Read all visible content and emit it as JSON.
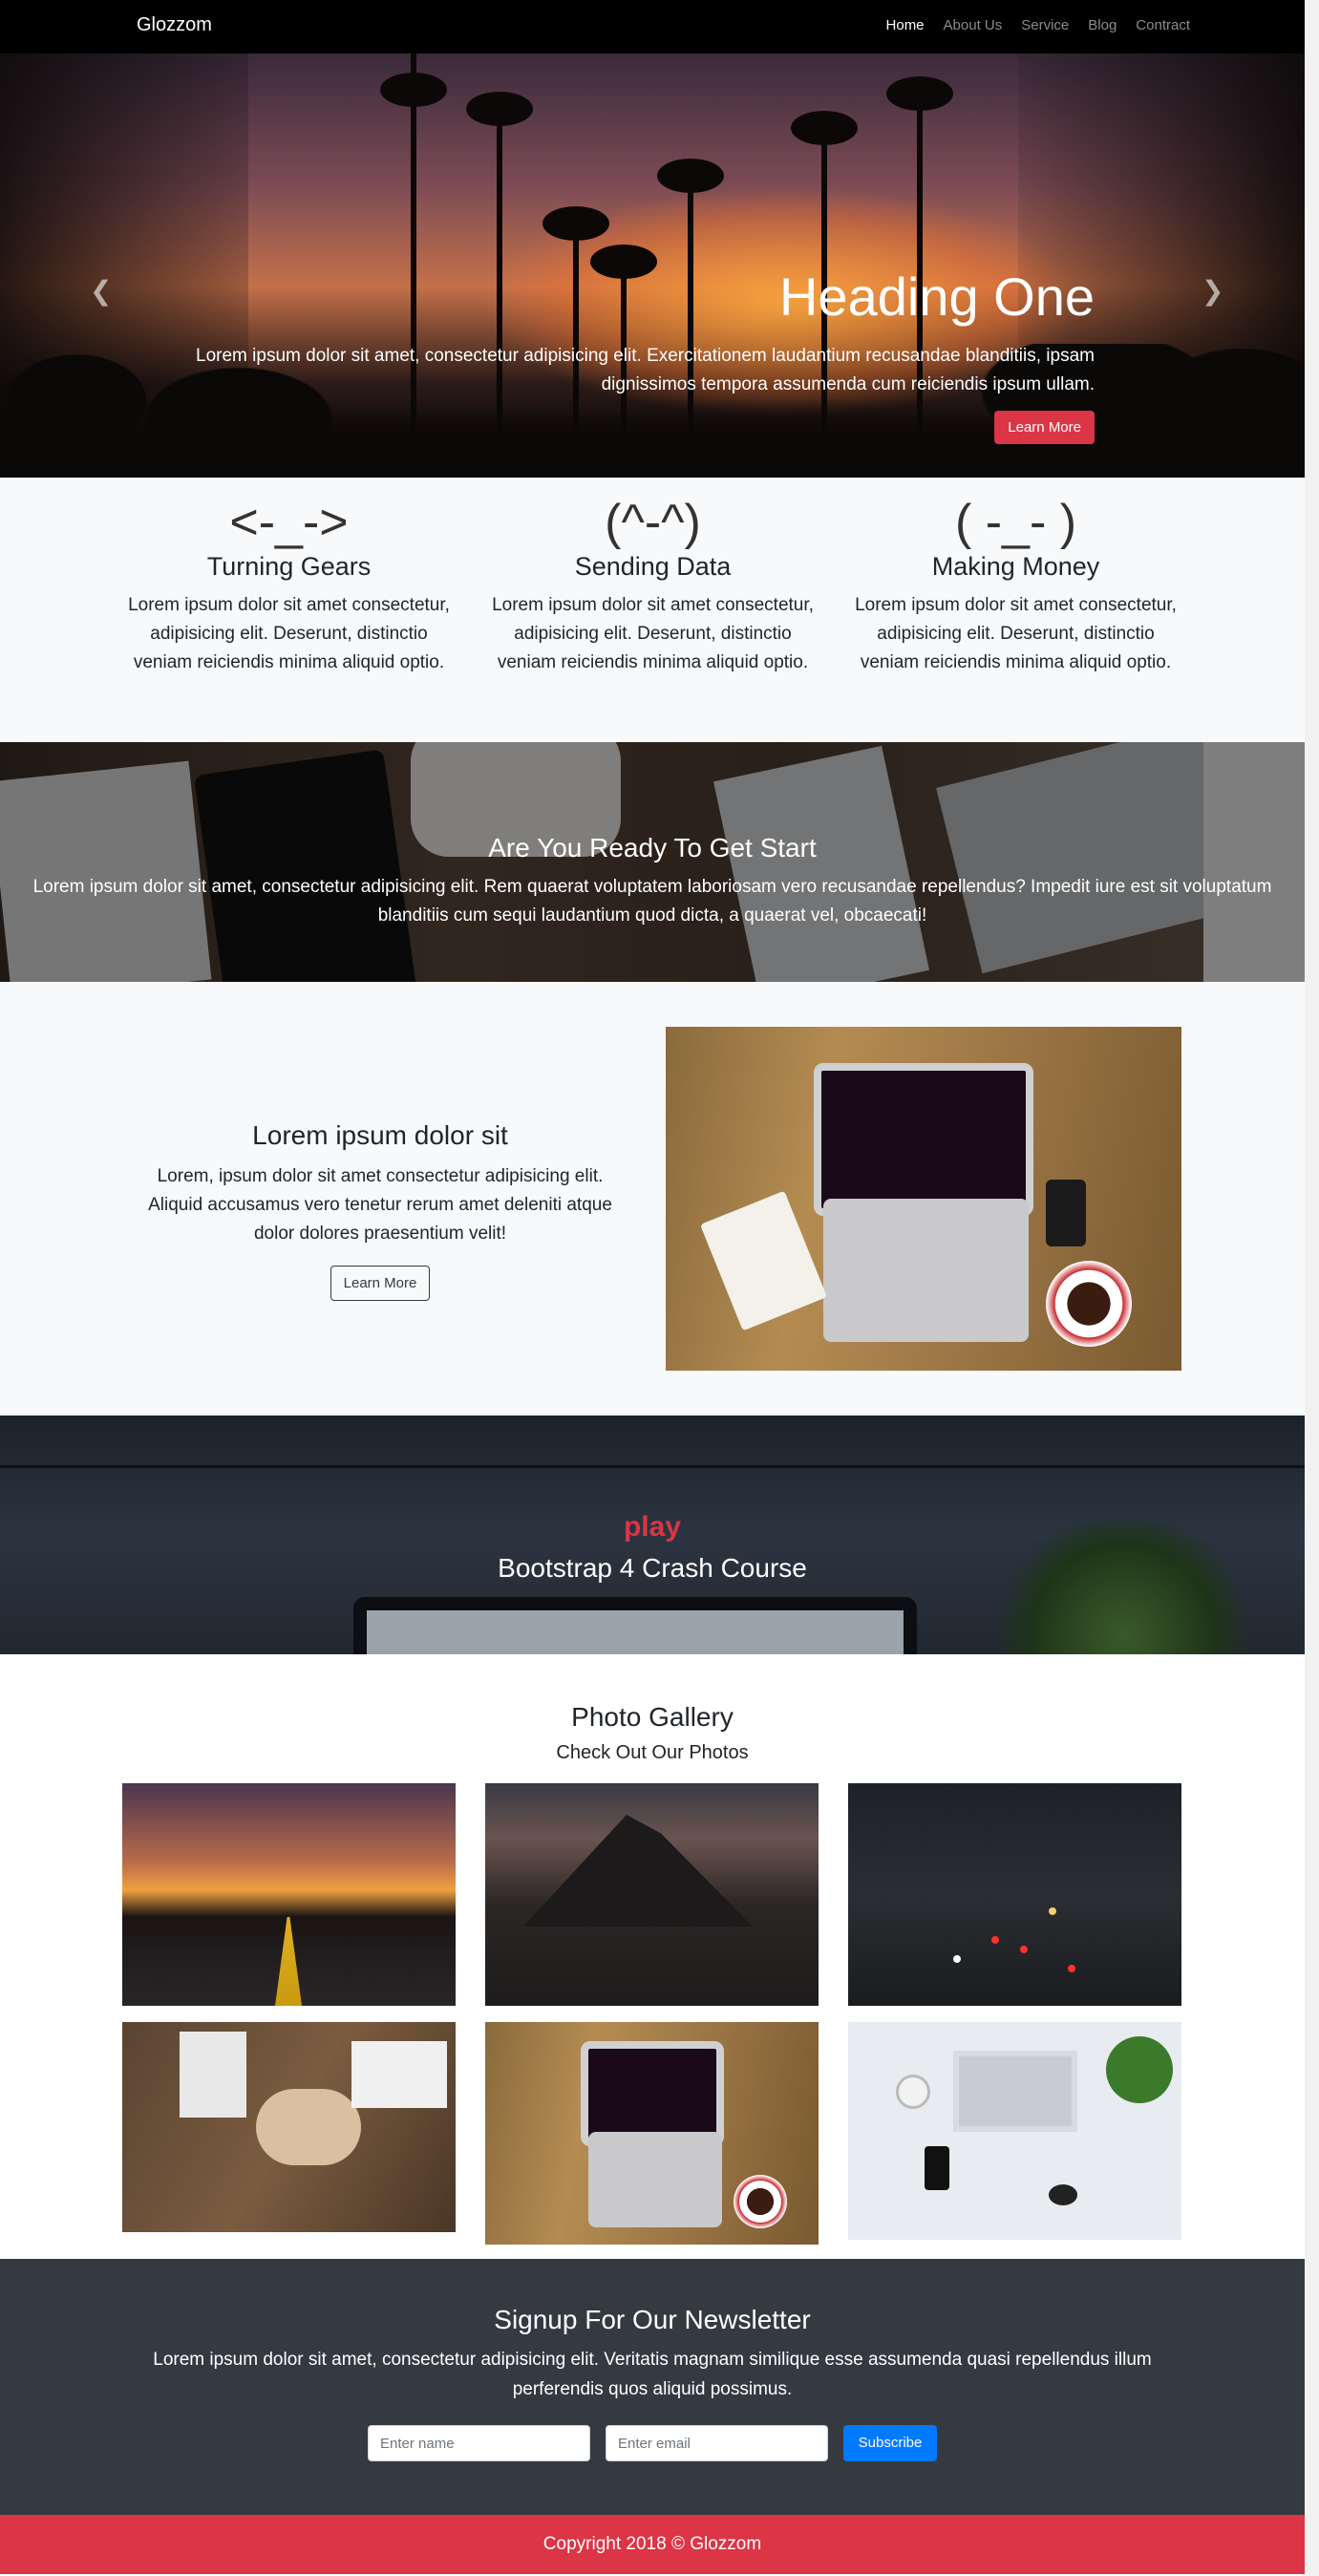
{
  "nav": {
    "brand": "Glozzom",
    "links": [
      "Home",
      "About Us",
      "Service",
      "Blog",
      "Contract"
    ],
    "active": "Home"
  },
  "hero": {
    "heading": "Heading One",
    "text": "Lorem ipsum dolor sit amet, consectetur adipisicing elit. Exercitationem laudantium recusandae blanditiis, ipsam dignissimos tempora assumenda cum reiciendis ipsum ullam.",
    "button": "Learn More",
    "prev_icon": "chevron-left-icon",
    "next_icon": "chevron-right-icon",
    "slides": 3,
    "active_slide": 1
  },
  "features": [
    {
      "emoticon": "<-_->",
      "title": "Turning Gears",
      "text": "Lorem ipsum dolor sit amet consectetur, adipisicing elit. Deserunt, distinctio veniam reiciendis minima aliquid optio."
    },
    {
      "emoticon": "(^-^)",
      "title": "Sending Data",
      "text": "Lorem ipsum dolor sit amet consectetur, adipisicing elit. Deserunt, distinctio veniam reiciendis minima aliquid optio."
    },
    {
      "emoticon": "( -_- )",
      "title": "Making Money",
      "text": "Lorem ipsum dolor sit amet consectetur, adipisicing elit. Deserunt, distinctio veniam reiciendis minima aliquid optio."
    }
  ],
  "ready": {
    "title": "Are You Ready To Get Start",
    "text": "Lorem ipsum dolor sit amet, consectetur adipisicing elit. Rem quaerat voluptatem laboriosam vero recusandae repellendus? Impedit iure est sit voluptatum blanditiis cum sequi laudantium quod dicta, a quaerat vel, obcaecati!"
  },
  "info": {
    "title": "Lorem ipsum dolor sit",
    "text": "Lorem, ipsum dolor sit amet consectetur adipisicing elit. Aliquid accusamus vero tenetur rerum amet deleniti atque dolor dolores praesentium velit!",
    "button": "Learn More"
  },
  "video": {
    "play": "play",
    "title": "Bootstrap 4 Crash Course"
  },
  "gallery": {
    "title": "Photo Gallery",
    "subtitle": "Check Out Our Photos"
  },
  "newsletter": {
    "title": "Signup For Our Newsletter",
    "text": "Lorem ipsum dolor sit amet, consectetur adipisicing elit. Veritatis magnam similique esse assumenda quasi repellendus illum perferendis quos aliquid possimus.",
    "name_placeholder": "Enter name",
    "email_placeholder": "Enter email",
    "button": "Subscribe"
  },
  "footer": {
    "copyright": "Copyright 2018 © Glozzom"
  },
  "colors": {
    "danger": "#dc3545",
    "primary": "#007bff",
    "dark": "#343a40"
  }
}
